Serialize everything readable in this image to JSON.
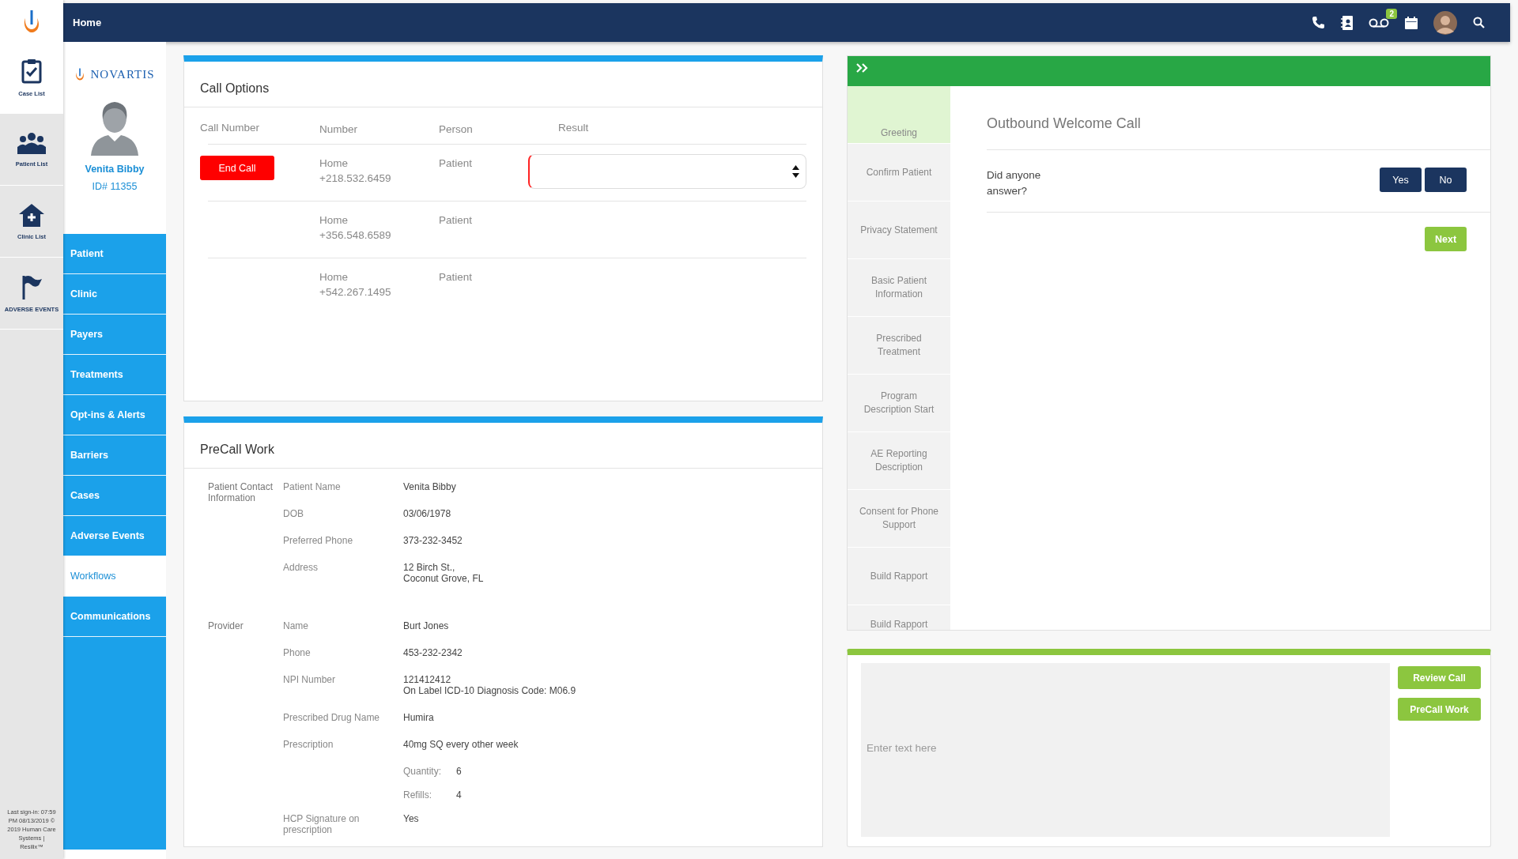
{
  "rail": {
    "items": [
      {
        "label": "Case List",
        "selected": true
      },
      {
        "label": "Patient List",
        "selected": false
      },
      {
        "label": "Clinic List",
        "selected": false
      },
      {
        "label": "ADVERSE EVENTS",
        "selected": false
      }
    ],
    "footer": "Last sign-in: 07:59 PM 08/13/2019 © 2019 Human Care Systems | Resilix™"
  },
  "top_bar": {
    "title": "Home",
    "voicemail_count": "2"
  },
  "sidebar": {
    "brand": "NOVARTIS",
    "patient_name": "Venita Bibby",
    "patient_id": "ID# 11355",
    "items": [
      {
        "label": "Patient",
        "selected": false
      },
      {
        "label": "Clinic",
        "selected": false
      },
      {
        "label": "Payers",
        "selected": false
      },
      {
        "label": "Treatments",
        "selected": false
      },
      {
        "label": "Opt-ins & Alerts",
        "selected": false
      },
      {
        "label": "Barriers",
        "selected": false
      },
      {
        "label": "Cases",
        "selected": false
      },
      {
        "label": "Adverse Events",
        "selected": false
      },
      {
        "label": "Workflows",
        "selected": true
      },
      {
        "label": "Communications",
        "selected": false
      }
    ]
  },
  "call_options": {
    "title": "Call Options",
    "columns": [
      "Call Number",
      "Number",
      "Person",
      "Result"
    ],
    "rows": [
      {
        "end_call": "End Call",
        "type": "Home",
        "number": "+218.532.6459",
        "person": "Patient",
        "result_field": true
      },
      {
        "type": "Home",
        "number": "+356.548.6589",
        "person": "Patient",
        "result_field": false
      },
      {
        "type": "Home",
        "number": "+542.267.1495",
        "person": "Patient",
        "result_field": false
      }
    ]
  },
  "precall": {
    "title": "PreCall Work",
    "sections": [
      {
        "heading": "Patient Contact Information",
        "fields": [
          {
            "kind": "field",
            "label": "Patient Name",
            "value": "Venita Bibby"
          },
          {
            "kind": "field",
            "label": "DOB",
            "value": "03/06/1978"
          },
          {
            "kind": "field",
            "label": "Preferred Phone",
            "value": "373-232-3452"
          },
          {
            "kind": "field",
            "label": "Address",
            "value": "12 Birch St.,\nCoconut Grove, FL"
          }
        ]
      },
      {
        "heading": "Provider",
        "fields": [
          {
            "kind": "field",
            "label": "Name",
            "value": "Burt Jones"
          },
          {
            "kind": "field",
            "label": "Phone",
            "value": "453-232-2342"
          },
          {
            "kind": "field",
            "label": "NPI Number",
            "value": "121412412\nOn Label ICD-10 Diagnosis Code: M06.9"
          },
          {
            "kind": "field",
            "label": "Prescribed Drug Name",
            "value": "Humira"
          },
          {
            "kind": "field",
            "label": "Prescription",
            "value": "40mg SQ every other week"
          },
          {
            "kind": "sub",
            "label": "Quantity:",
            "value": "6"
          },
          {
            "kind": "sub",
            "label": "Refills:",
            "value": "4"
          },
          {
            "kind": "field",
            "label": "HCP Signature on prescription",
            "value": "Yes"
          }
        ]
      }
    ]
  },
  "workflow": {
    "title": "Outbound Welcome Call",
    "steps": [
      {
        "label": "Greeting",
        "selected": true
      },
      {
        "label": "Confirm Patient",
        "selected": false
      },
      {
        "label": "Privacy Statement",
        "selected": false
      },
      {
        "label": "Basic Patient Information",
        "selected": false
      },
      {
        "label": "Prescribed Treatment",
        "selected": false
      },
      {
        "label": "Program Description Start",
        "selected": false
      },
      {
        "label": "AE Reporting Description",
        "selected": false
      },
      {
        "label": "Consent for Phone Support",
        "selected": false
      },
      {
        "label": "Build Rapport",
        "selected": false
      },
      {
        "label": "Build Rapport",
        "selected": false
      }
    ],
    "question": "Did anyone answer?",
    "answers": [
      "Yes",
      "No"
    ],
    "next": "Next"
  },
  "notes": {
    "placeholder": "Enter text here",
    "buttons": [
      "Review Call",
      "PreCall Work"
    ]
  }
}
